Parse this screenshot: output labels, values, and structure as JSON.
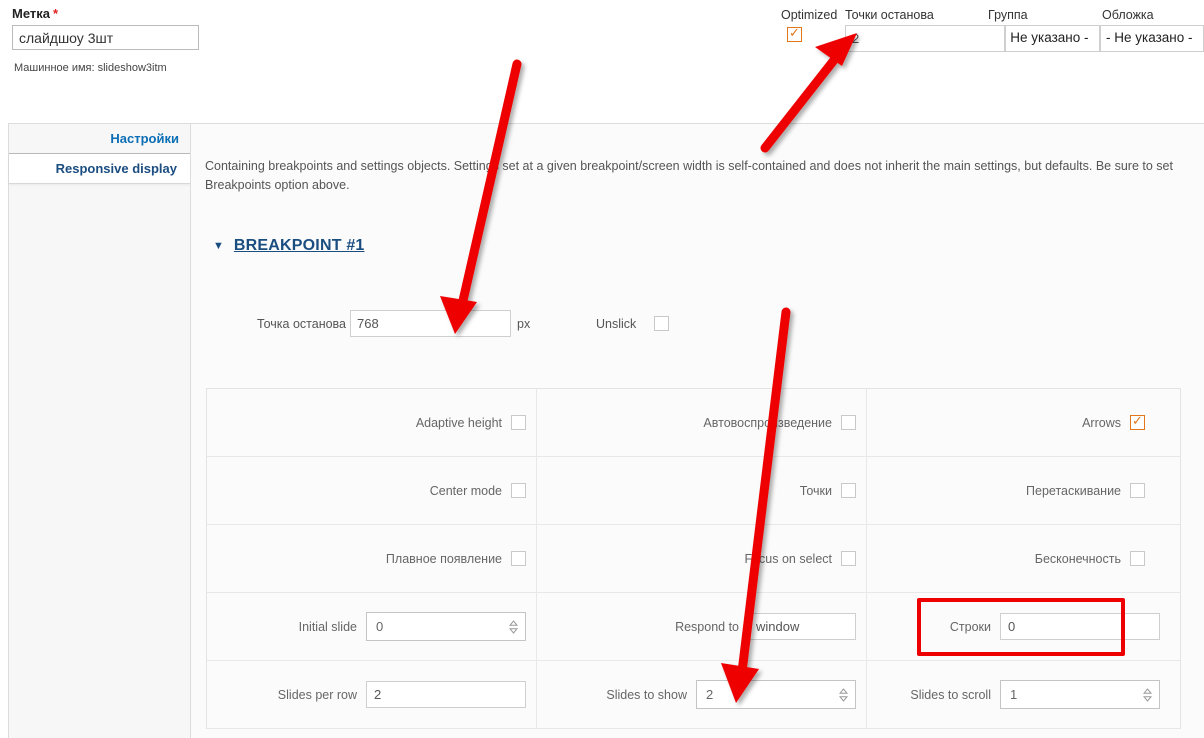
{
  "label_field": {
    "label": "Метка",
    "required_mark": "*",
    "value": "слайдшоу 3шт",
    "machine_name": "Машинное имя: slideshow3itm"
  },
  "header": {
    "optimized_label": "Optimized",
    "optimized_checked": true,
    "breakpoints_label": "Точки останова",
    "breakpoints_value": "2",
    "group_label": "Группа",
    "group_value": "- Не указано -",
    "cover_label": "Обложка",
    "cover_value": "- Не указано -"
  },
  "tabs": [
    {
      "label": "Настройки",
      "active": false
    },
    {
      "label": "Responsive display",
      "active": true
    }
  ],
  "panel": {
    "description": "Containing breakpoints and settings objects. Settings set at a given breakpoint/screen width is self-contained and does not inherit the main settings, but defaults. Be sure to set Breakpoints option above.",
    "breakpoint_heading": "BREAKPOINT #1",
    "collapse_icon": "▼",
    "breakpoint_label": "Точка останова",
    "breakpoint_value": "768",
    "unit": "px",
    "unslick_label": "Unslick",
    "unslick_checked": false
  },
  "grid": {
    "rows": [
      {
        "cells": [
          {
            "label": "Adaptive height",
            "type": "checkbox",
            "checked": false
          },
          {
            "label": "Автовоспроизведение",
            "type": "checkbox",
            "checked": false
          },
          {
            "label": "Arrows",
            "type": "checkbox",
            "checked": true
          }
        ]
      },
      {
        "cells": [
          {
            "label": "Center mode",
            "type": "checkbox",
            "checked": false
          },
          {
            "label": "Точки",
            "type": "checkbox",
            "checked": false
          },
          {
            "label": "Перетаскивание",
            "type": "checkbox",
            "checked": false
          }
        ]
      },
      {
        "cells": [
          {
            "label": "Плавное появление",
            "type": "checkbox",
            "checked": false
          },
          {
            "label": "Focus on select",
            "type": "checkbox",
            "checked": false
          },
          {
            "label": "Бесконечность",
            "type": "checkbox",
            "checked": false
          }
        ]
      },
      {
        "cells": [
          {
            "label": "Initial slide",
            "type": "number",
            "value": "0"
          },
          {
            "label": "Respond to",
            "type": "text",
            "value": "window"
          },
          {
            "label": "Строки",
            "type": "text",
            "value": "0",
            "highlighted": true
          }
        ]
      },
      {
        "cells": [
          {
            "label": "Slides per row",
            "type": "text",
            "value": "2"
          },
          {
            "label": "Slides to show",
            "type": "number",
            "value": "2"
          },
          {
            "label": "Slides to scroll",
            "type": "number",
            "value": "1"
          }
        ]
      }
    ]
  },
  "annotations": {
    "arrow_color": "#ef0000",
    "rect_color": "#ef0000",
    "arrow_count": 3
  }
}
